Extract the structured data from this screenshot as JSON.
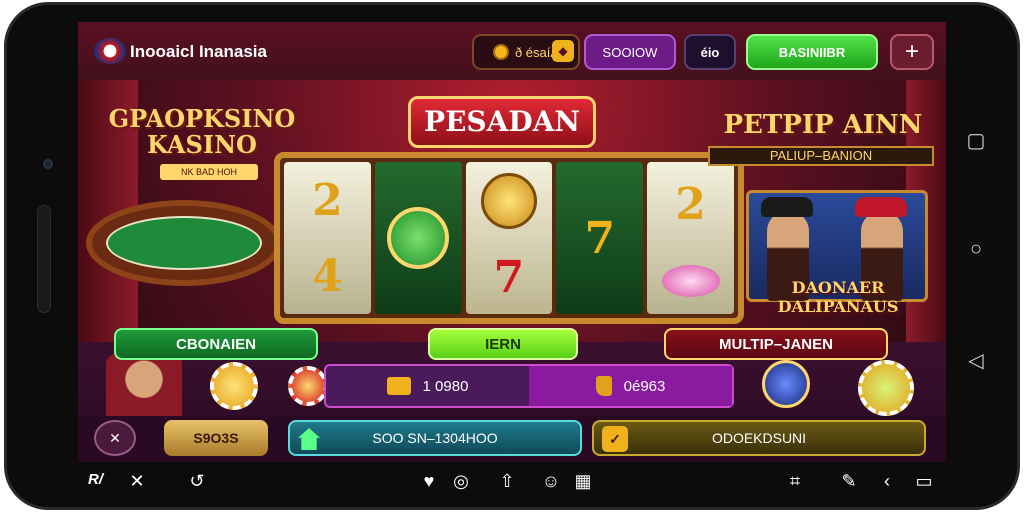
{
  "header": {
    "app_title": "Inooaicl Inanasia",
    "wallet_label": "ð ésaíÄ",
    "balance_label": "SOOIOW",
    "menu_label": "éio",
    "deposit_label": "BASINIIBR",
    "plus_label": "+"
  },
  "banner": {
    "left_title": "GPAOPKSINO KASINO",
    "left_subtitle": "NK BAD HOH",
    "marquee_title": "PESADAN",
    "right_title": "PETPIP AINN",
    "right_subtitle": "PALIUP–BANION",
    "hosts_label": "DAONAER DALIPANAUS"
  },
  "reels": {
    "r1": [
      "2",
      "4"
    ],
    "r3": [
      "7"
    ],
    "r4": [
      "7"
    ],
    "r5": [
      "2"
    ]
  },
  "actions": {
    "green_dark_label": "CBONAIEN",
    "green_light_label": "IERN",
    "red_label": "MULTIP–JANEN"
  },
  "stats": {
    "left_value": "1 0980",
    "right_value": "0é963"
  },
  "footer": {
    "amount_label": "S9O3S",
    "phone_label": "SOO SN–1304HOO",
    "promo_label": "ODOEKDSUNI"
  },
  "navbar": {
    "left_label": "R/"
  },
  "colors": {
    "header_bg": "#5b0f22",
    "deposit_green": "#1fa51b",
    "balance_purple": "#6b1a86",
    "accent_gold": "#ffd66b"
  },
  "icons": [
    "close-icon",
    "back-icon",
    "heart-icon",
    "gear-icon",
    "upload-icon",
    "emoji-icon",
    "grid-icon",
    "bracket-icon",
    "brush-icon",
    "arrow-left-icon",
    "battery-icon",
    "square-icon",
    "circle-icon",
    "triangle-icon"
  ]
}
